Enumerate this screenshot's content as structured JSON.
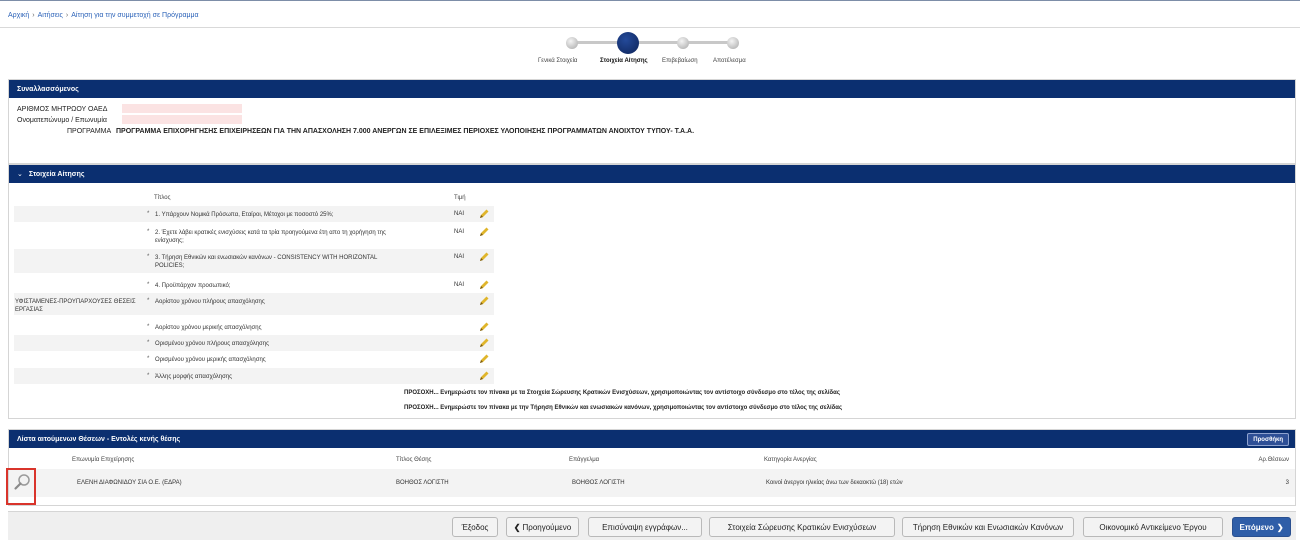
{
  "breadcrumb": [
    "Αρχική",
    "Αιτήσεις",
    "Αίτηση για την συμμετοχή σε Πρόγραμμα"
  ],
  "breadcrumb_sep": "›",
  "wizard": {
    "steps": [
      "Γενικά Στοιχεία",
      "Στοιχεία Αίτησης",
      "Επιβεβαίωση",
      "Αποτέλεσμα"
    ],
    "active_index": 1
  },
  "panel_transactor": {
    "title": "Συναλλασσόμενος",
    "registry_label": "ΑΡΙΘΜΟΣ ΜΗΤΡΩΟΥ ΟΑΕΔ",
    "name_label": "Ονοματεπώνυμο / Επωνυμία",
    "program_label": "ΠΡΟΓΡΑΜΜΑ",
    "program_value": "ΠΡΟΓΡΑΜΜΑ ΕΠΙΧΟΡΗΓΗΣΗΣ ΕΠΙΧΕΙΡΗΣΕΩΝ ΓΙΑ ΤΗΝ ΑΠΑΣΧΟΛΗΣΗ 7.000 ΑΝΕΡΓΩΝ ΣΕ ΕΠΙΛΕΞΙΜΕΣ ΠΕΡΙΟΧΕΣ ΥΛΟΠΟΙΗΣΗΣ ΠΡΟΓΡΑΜΜΑΤΩΝ ΑΝΟΙΧΤΟΥ ΤΥΠΟΥ- Τ.Α.Α."
  },
  "panel_application": {
    "chevron": "⌄",
    "title": "Στοιχεία Αίτησης",
    "col_title": "Τίτλος",
    "col_value": "Τιμή",
    "rows": [
      {
        "bullet": "*",
        "q1": "1. Υπάρχουν Νομικά Πρόσωπα, Εταίροι, Μέτοχοι με ποσοστό 25%;",
        "q2": "",
        "value": "ΝΑΙ"
      },
      {
        "bullet": "*",
        "q1": "2. Έχετε λάβει κρατικές ενισχύσεις κατά τα τρία προηγούμενα έτη απο τη χορήγηση της",
        "q2": "ενίσχυσης;",
        "value": "ΝΑΙ"
      },
      {
        "bullet": "*",
        "q1": "3. Τήρηση Εθνικών και ενωσιακών κανόνων - CONSISTENCY WITH HORIZONTAL",
        "q2": "POLICIES;",
        "value": "ΝΑΙ"
      },
      {
        "bullet": "*",
        "q1": "4. Προϋπάρχον προσωπικό;",
        "q2": "",
        "value": "ΝΑΙ"
      },
      {
        "bullet": "*",
        "q1": "Αορίστου χρόνου πλήρους απασχόλησης",
        "q2": "",
        "value": ""
      },
      {
        "bullet": "*",
        "q1": "Αορίστου χρόνου μερικής απασχόλησης",
        "q2": "",
        "value": ""
      },
      {
        "bullet": "*",
        "q1": "Ορισμένου χρόνου πλήρους απασχόλησης",
        "q2": "",
        "value": ""
      },
      {
        "bullet": "*",
        "q1": "Ορισμένου χρόνου μερικής απασχόλησης",
        "q2": "",
        "value": ""
      },
      {
        "bullet": "*",
        "q1": "Άλλης μορφής απασχόλησης",
        "q2": "",
        "value": ""
      }
    ],
    "group_label": "ΥΦΙΣΤΑΜΕΝΕΣ-ΠΡΟΥΠΑΡΧΟΥΣΕΣ ΘΕΣΕΙΣ ΕΡΓΑΣΙΑΣ",
    "warning_1": "ΠΡΟΣΟΧΗ... Ενημερώστε τον πίνακα με τα Στοιχεία Σώρευσης Κρατικών Ενισχύσεων, χρησιμοποιώντας τον αντίστοιχο σύνδεσμο στο τέλος της σελίδας",
    "warning_2": "ΠΡΟΣΟΧΗ... Ενημερώστε τον πίνακα με την Τήρηση Εθνικών και ενωσιακών κανόνων, χρησιμοποιώντας τον αντίστοιχο σύνδεσμο στο τέλος της σελίδας"
  },
  "panel_positions": {
    "title": "Λίστα αιτούμενων Θέσεων - Εντολές κενής θέσης",
    "add_label": "Προσθήκη",
    "columns": [
      "Επωνυμία Επιχείρησης",
      "Τίτλος Θέσης",
      "Επάγγελμα",
      "Κατηγορία Ανεργίας",
      "Αρ.Θέσεων"
    ],
    "rows": [
      {
        "company": "ΕΛΕΝΗ ΔΙΑΦΩΝΙΔΟΥ ΣΙΑ Ο.Ε. (ΕΔΡΑ)",
        "title": "ΒΟΗΘΟΣ ΛΟΓΙΣΤΗ",
        "profession": "ΒΟΗΘΟΣ ΛΟΓΙΣΤΗ",
        "category": "Κοινοί άνεργοι ηλικίας άνω των δεκαοκτώ (18) ετών",
        "count": "3"
      }
    ]
  },
  "footer": {
    "exit": "Έξοδος",
    "prev": "Προηγούμενο",
    "prev_icon": "❮",
    "attach": "Επισύναψη εγγράφων...",
    "aid": "Στοιχεία Σώρευσης Κρατικών Ενισχύσεων",
    "rules": "Τήρηση Εθνικών και Ενωσιακών Κανόνων",
    "object": "Οικονομικό Αντικείμενο Έργου",
    "next": "Επόμενο",
    "next_icon": "❯"
  },
  "colors": {
    "header_blue": "#0b2f70",
    "primary_button": "#2f5ea8",
    "highlight_red": "#d9342b",
    "pencil": "#e0b52b"
  }
}
